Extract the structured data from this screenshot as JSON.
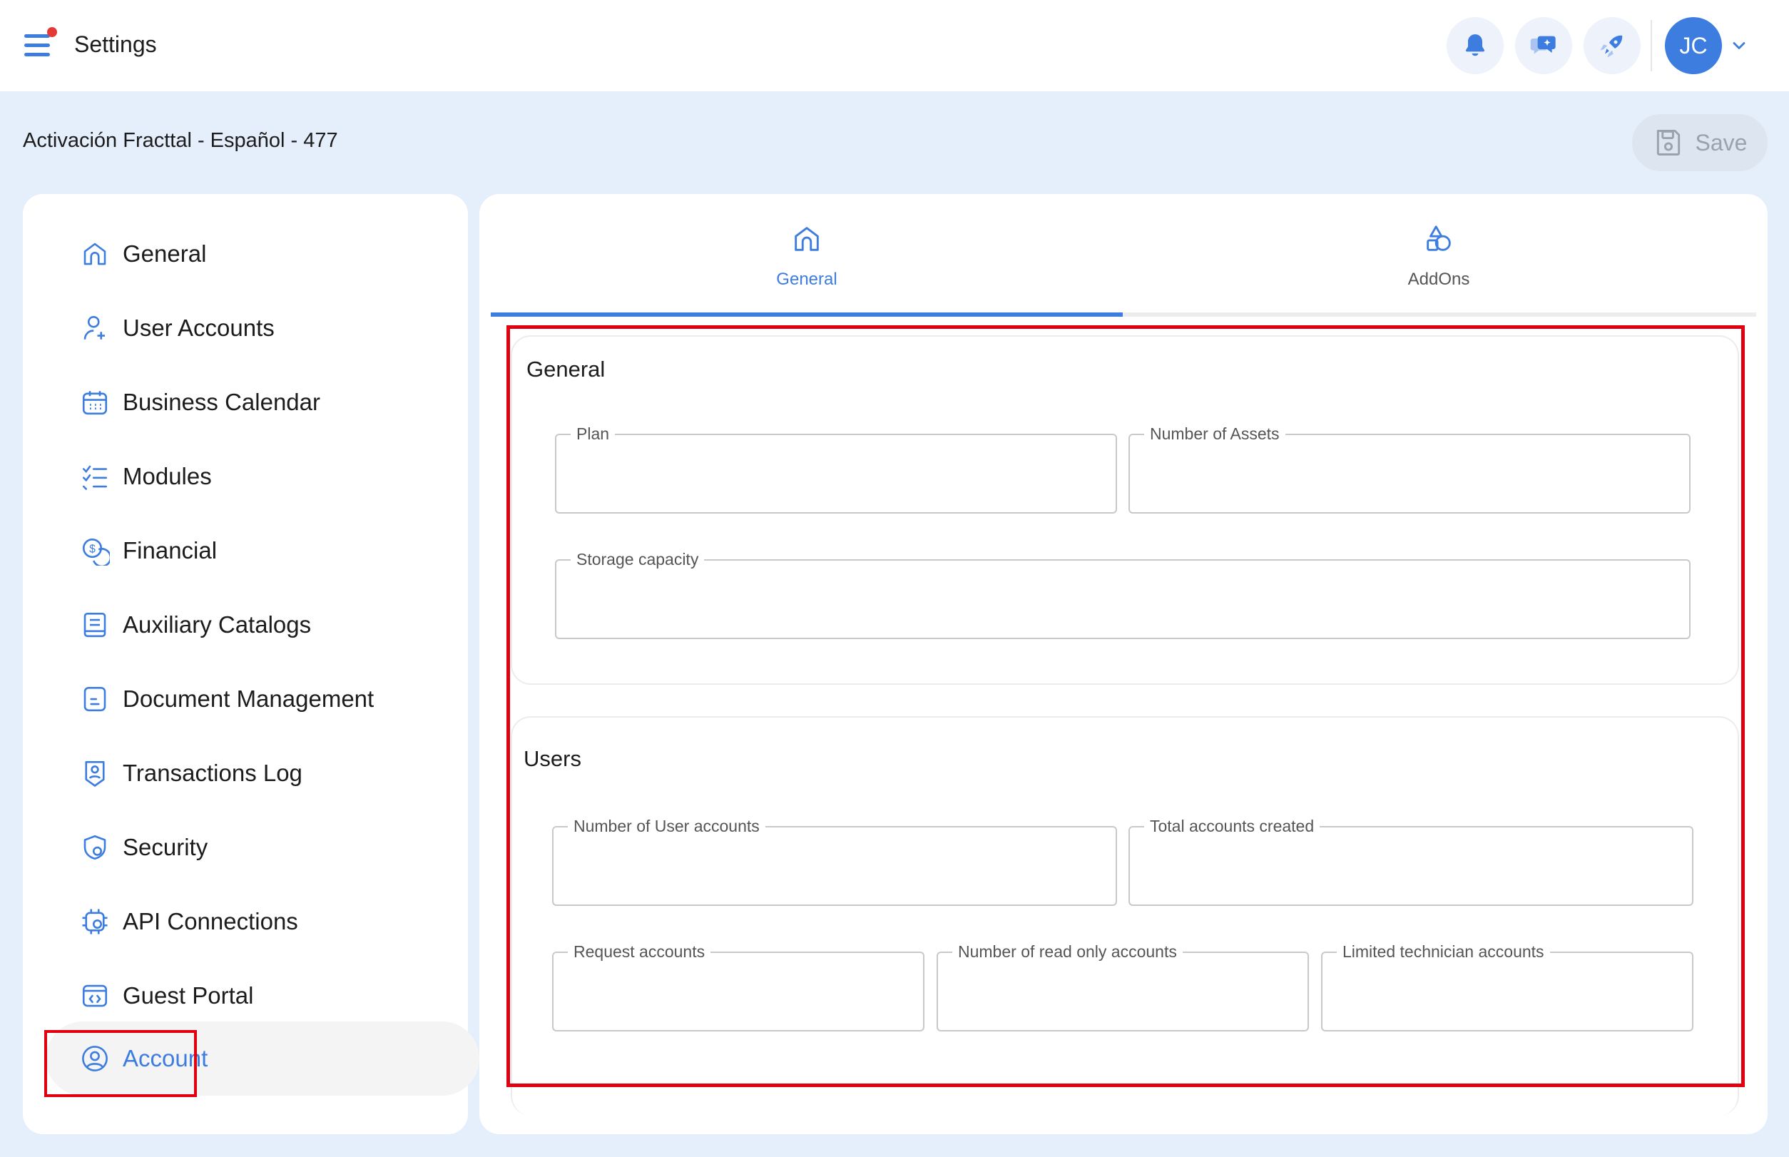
{
  "header": {
    "title": "Settings",
    "avatar_initials": "JC",
    "icons": [
      "bell-icon",
      "chat-sparkle-icon",
      "rocket-icon",
      "chevron-down-icon"
    ]
  },
  "subheader": {
    "org_title": "Activación Fracttal - Español - 477",
    "save_label": "Save"
  },
  "sidebar": {
    "items": [
      {
        "label": "General",
        "icon": "home-icon"
      },
      {
        "label": "User Accounts",
        "icon": "user-add-icon"
      },
      {
        "label": "Business Calendar",
        "icon": "calendar-icon"
      },
      {
        "label": "Modules",
        "icon": "checklist-icon"
      },
      {
        "label": "Financial",
        "icon": "coins-icon"
      },
      {
        "label": "Auxiliary Catalogs",
        "icon": "book-icon"
      },
      {
        "label": "Document Management",
        "icon": "document-icon"
      },
      {
        "label": "Transactions Log",
        "icon": "log-shield-icon"
      },
      {
        "label": "Security",
        "icon": "security-shield-icon"
      },
      {
        "label": "API Connections",
        "icon": "api-gear-icon"
      },
      {
        "label": "Guest Portal",
        "icon": "browser-code-icon"
      },
      {
        "label": "Account",
        "icon": "account-circle-icon",
        "active": true
      }
    ]
  },
  "tabs": [
    {
      "label": "General",
      "icon": "home-icon",
      "active": true
    },
    {
      "label": "AddOns",
      "icon": "shapes-icon",
      "active": false
    }
  ],
  "general_section": {
    "title": "General",
    "fields": {
      "plan": {
        "label": "Plan",
        "value": ""
      },
      "number_of_assets": {
        "label": "Number of Assets",
        "value": ""
      },
      "storage_capacity": {
        "label": "Storage capacity",
        "value": ""
      }
    }
  },
  "users_section": {
    "title": "Users",
    "fields": {
      "number_of_user_accounts": {
        "label": "Number of User accounts",
        "value": ""
      },
      "total_accounts_created": {
        "label": "Total accounts created",
        "value": ""
      },
      "request_accounts": {
        "label": "Request accounts",
        "value": ""
      },
      "read_only_accounts": {
        "label": "Number of read only accounts",
        "value": ""
      },
      "limited_technician_accounts": {
        "label": "Limited technician accounts",
        "value": ""
      }
    }
  },
  "colors": {
    "accent": "#3d7de0",
    "background": "#e5eefb",
    "highlight_box": "#e0000f"
  }
}
